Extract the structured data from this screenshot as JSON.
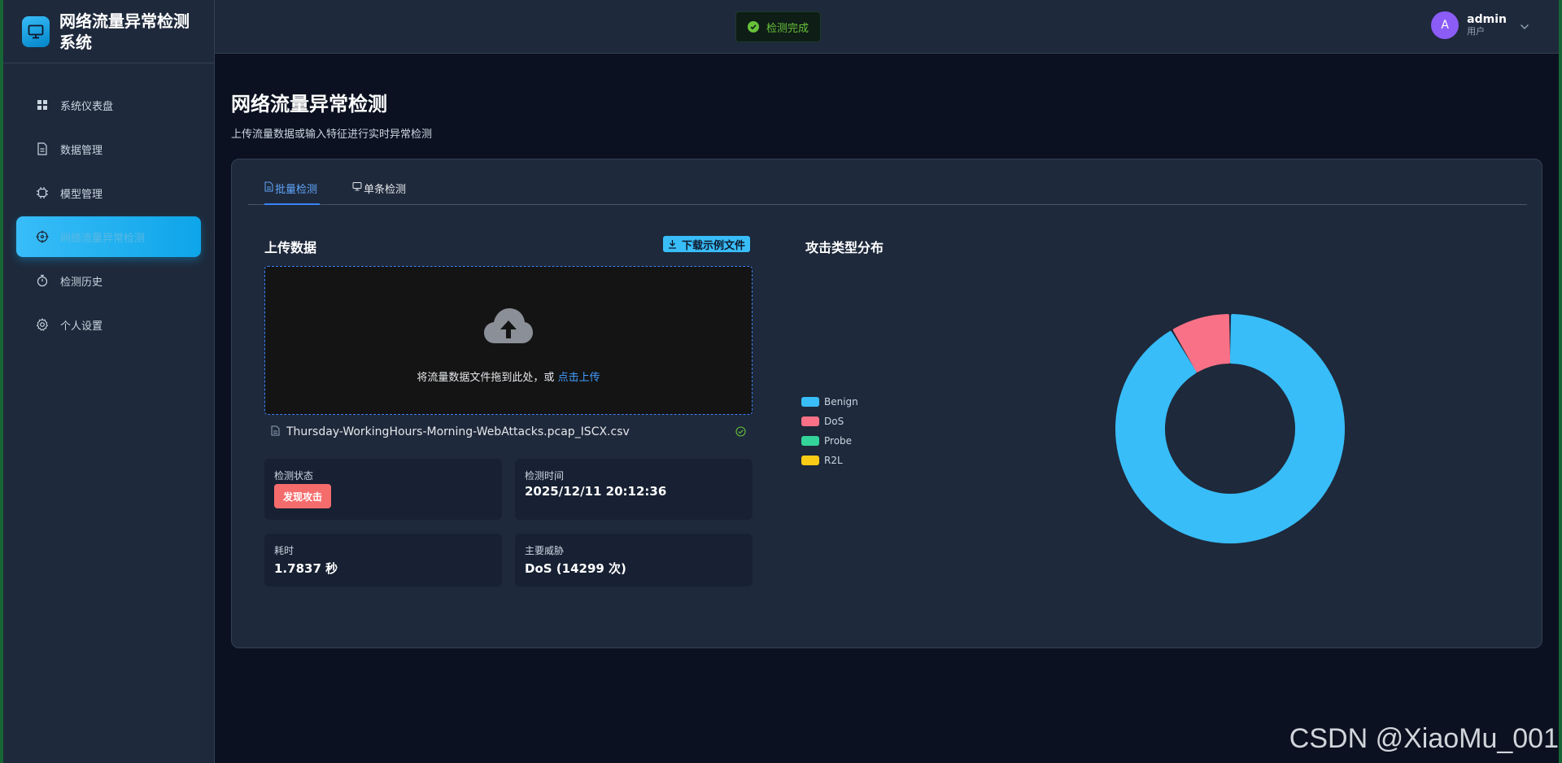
{
  "app": {
    "title": "网络流量异常检测系统"
  },
  "sidebar": {
    "items": [
      {
        "label": "系统仪表盘",
        "icon": "grid-icon"
      },
      {
        "label": "数据管理",
        "icon": "document-icon"
      },
      {
        "label": "模型管理",
        "icon": "cpu-icon"
      },
      {
        "label": "网络流量异常检测",
        "icon": "target-icon",
        "active": true
      },
      {
        "label": "检测历史",
        "icon": "stopwatch-icon"
      },
      {
        "label": "个人设置",
        "icon": "gear-icon"
      }
    ]
  },
  "header": {
    "toast": "检测完成",
    "user": {
      "avatar": "A",
      "name": "admin",
      "role": "用户"
    }
  },
  "page": {
    "title": "网络流量异常检测",
    "subtitle": "上传流量数据或输入特征进行实时异常检测"
  },
  "tabs": [
    {
      "label": "批量检测",
      "icon": "document-icon",
      "active": true
    },
    {
      "label": "单条检测",
      "icon": "monitor-icon"
    }
  ],
  "upload": {
    "title": "上传数据",
    "download_label": "下载示例文件",
    "drop_text": "将流量数据文件拖到此处，或",
    "drop_link": "点击上传",
    "file_name": "Thursday-WorkingHours-Morning-WebAttacks.pcap_ISCX.csv"
  },
  "stats": {
    "status_label": "检测状态",
    "status_value": "发现攻击",
    "time_label": "检测时间",
    "time_value": "2025/12/11 20:12:36",
    "duration_label": "耗时",
    "duration_value": "1.7837 秒",
    "threat_label": "主要威胁",
    "threat_value": "DoS (14299 次)"
  },
  "chart_section": {
    "title": "攻击类型分布"
  },
  "chart_data": {
    "type": "pie",
    "donut": true,
    "legend_position": "left",
    "categories": [
      "Benign",
      "DoS",
      "Probe",
      "R2L"
    ],
    "values": [
      91.5,
      8.5,
      0,
      0
    ],
    "colors": [
      "#38bdf8",
      "#f87186",
      "#34d399",
      "#facc15"
    ]
  },
  "watermark": "CSDN @XiaoMu_001"
}
